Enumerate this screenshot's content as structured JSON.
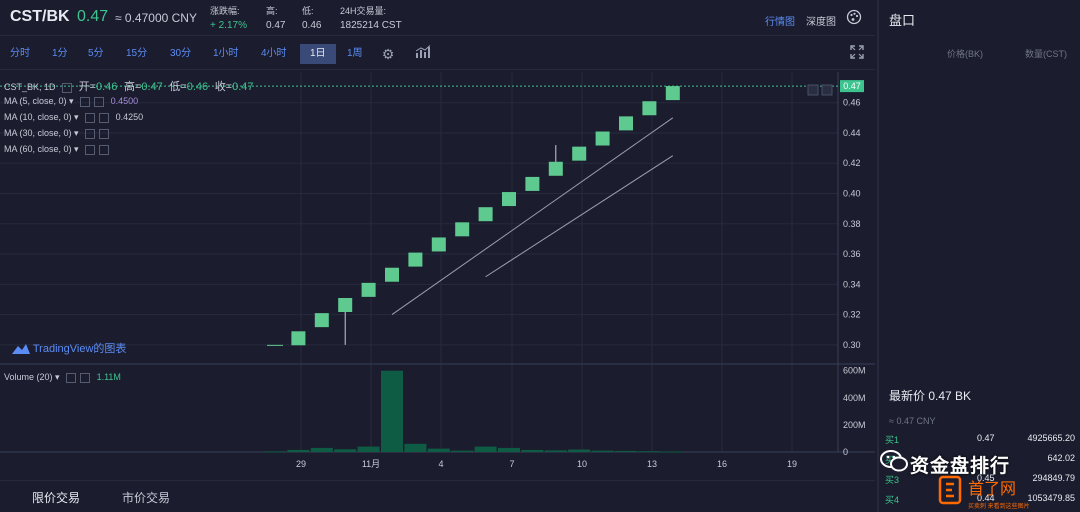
{
  "header": {
    "pair": "CST/BK",
    "price": "0.47",
    "price_cny": "≈ 0.47000 CNY",
    "change_label": "涨跌幅:",
    "change_value": "+ 2.17%",
    "high_label": "高:",
    "high_value": "0.47",
    "low_label": "低:",
    "low_value": "0.46",
    "volume_label": "24H交易量:",
    "volume_value": "1825214 CST",
    "link_quote": "行情图",
    "link_depth": "深度图",
    "palette_icon": "palette-icon"
  },
  "timeframes": [
    {
      "label": "分时",
      "active": false
    },
    {
      "label": "1分",
      "active": false
    },
    {
      "label": "5分",
      "active": false
    },
    {
      "label": "15分",
      "active": false
    },
    {
      "label": "30分",
      "active": false
    },
    {
      "label": "1小时",
      "active": false
    },
    {
      "label": "4小时",
      "active": false
    },
    {
      "label": "1日",
      "active": true
    },
    {
      "label": "1周",
      "active": false
    }
  ],
  "toolbar_icons": [
    "gear-icon",
    "indicators-icon",
    "fullscreen-icon"
  ],
  "legend": {
    "symbol": "CST_BK, 1D",
    "open_label": "开=",
    "open": "0.46",
    "high_label": "高=",
    "high": "0.47",
    "low_label": "低=",
    "low": "0.46",
    "close_label": "收=",
    "close": "0.47",
    "ma5": "MA (5, close, 0)",
    "ma5_value": "0.4500",
    "ma10": "MA (10, close, 0)",
    "ma10_value": "0.4250",
    "ma30": "MA (30, close, 0)",
    "ma60": "MA (60, close, 0)",
    "volume": "Volume (20)",
    "volume_value": "1.11M",
    "tradingview": "TradingView的图表"
  },
  "price_axis_labels": [
    "0.46",
    "0.44",
    "0.42",
    "0.40",
    "0.38",
    "0.36",
    "0.34",
    "0.32",
    "0.30"
  ],
  "current_price_tag": "0.47",
  "volume_axis_labels": [
    "600M",
    "400M",
    "200M",
    "0"
  ],
  "date_axis_labels": [
    "29",
    "11月",
    "4",
    "7",
    "10",
    "13",
    "16",
    "19"
  ],
  "chart_data": {
    "type": "candlestick",
    "price_ylim": [
      0.29,
      0.475
    ],
    "candles": [
      {
        "day": "28",
        "open": 0.3,
        "close": 0.3,
        "high": 0.3,
        "low": 0.3
      },
      {
        "day": "29",
        "open": 0.3,
        "close": 0.305,
        "high": 0.305,
        "low": 0.3
      },
      {
        "day": "30",
        "open": 0.312,
        "close": 0.317,
        "high": 0.317,
        "low": 0.312
      },
      {
        "day": "31",
        "open": 0.322,
        "close": 0.327,
        "high": 0.327,
        "low": 0.3
      },
      {
        "day": "1",
        "open": 0.332,
        "close": 0.337,
        "high": 0.337,
        "low": 0.332
      },
      {
        "day": "2",
        "open": 0.342,
        "close": 0.347,
        "high": 0.347,
        "low": 0.342
      },
      {
        "day": "3",
        "open": 0.352,
        "close": 0.357,
        "high": 0.357,
        "low": 0.352
      },
      {
        "day": "4",
        "open": 0.362,
        "close": 0.367,
        "high": 0.367,
        "low": 0.362
      },
      {
        "day": "5",
        "open": 0.372,
        "close": 0.377,
        "high": 0.377,
        "low": 0.372
      },
      {
        "day": "6",
        "open": 0.382,
        "close": 0.387,
        "high": 0.387,
        "low": 0.382
      },
      {
        "day": "7",
        "open": 0.392,
        "close": 0.397,
        "high": 0.397,
        "low": 0.392
      },
      {
        "day": "8",
        "open": 0.402,
        "close": 0.407,
        "high": 0.407,
        "low": 0.402
      },
      {
        "day": "9",
        "open": 0.412,
        "close": 0.417,
        "high": 0.432,
        "low": 0.412
      },
      {
        "day": "10",
        "open": 0.422,
        "close": 0.427,
        "high": 0.427,
        "low": 0.422
      },
      {
        "day": "11",
        "open": 0.432,
        "close": 0.437,
        "high": 0.437,
        "low": 0.432
      },
      {
        "day": "12",
        "open": 0.442,
        "close": 0.447,
        "high": 0.447,
        "low": 0.442
      },
      {
        "day": "13",
        "open": 0.452,
        "close": 0.457,
        "high": 0.457,
        "low": 0.452
      },
      {
        "day": "14",
        "open": 0.462,
        "close": 0.467,
        "high": 0.467,
        "low": 0.462
      }
    ],
    "ma_lines": [
      {
        "name": "MA (5, close, 0)",
        "from": {
          "day": "2",
          "value": 0.32
        },
        "to": {
          "day": "14",
          "value": 0.45
        }
      },
      {
        "name": "MA (10, close, 0)",
        "from": {
          "day": "6",
          "value": 0.345
        },
        "to": {
          "day": "14",
          "value": 0.425
        }
      }
    ],
    "volume_ylim": [
      0,
      620
    ],
    "volume_unit": "M",
    "volumes": [
      {
        "day": "28",
        "value": 5
      },
      {
        "day": "29",
        "value": 15
      },
      {
        "day": "30",
        "value": 30
      },
      {
        "day": "31",
        "value": 20
      },
      {
        "day": "1",
        "value": 40
      },
      {
        "day": "2",
        "value": 600
      },
      {
        "day": "3",
        "value": 60
      },
      {
        "day": "4",
        "value": 25
      },
      {
        "day": "5",
        "value": 10
      },
      {
        "day": "6",
        "value": 40
      },
      {
        "day": "7",
        "value": 30
      },
      {
        "day": "8",
        "value": 15
      },
      {
        "day": "9",
        "value": 12
      },
      {
        "day": "10",
        "value": 18
      },
      {
        "day": "11",
        "value": 10
      },
      {
        "day": "12",
        "value": 8
      },
      {
        "day": "13",
        "value": 6
      },
      {
        "day": "14",
        "value": 4
      }
    ],
    "colors": {
      "up": "#5fca8f",
      "volume": "#0f5c44",
      "ma5": "#9b9eb3",
      "ma10": "#9b9eb3",
      "dashed": "#3dc48e"
    }
  },
  "panel": {
    "title": "盘口",
    "col_price": "价格(BK)",
    "col_qty": "数量(CST)",
    "latest": "最新价 0.47 BK",
    "latest_cny": "≈ 0.47 CNY",
    "bids": [
      {
        "label": "买1",
        "price": "0.47",
        "qty": "4925665.20"
      },
      {
        "label": "买2",
        "price": "",
        "qty": "642.02"
      },
      {
        "label": "买3",
        "price": "0.45",
        "qty": "294849.79"
      },
      {
        "label": "买4",
        "price": "0.44",
        "qty": "1053479.85"
      }
    ]
  },
  "bottom_tabs": [
    {
      "label": "限价交易",
      "active": true
    },
    {
      "label": "市价交易",
      "active": false
    }
  ],
  "watermark": {
    "main": "资金盘排行",
    "sub": "首了网",
    "tiny": "买卖刺  来看到这些图片"
  }
}
